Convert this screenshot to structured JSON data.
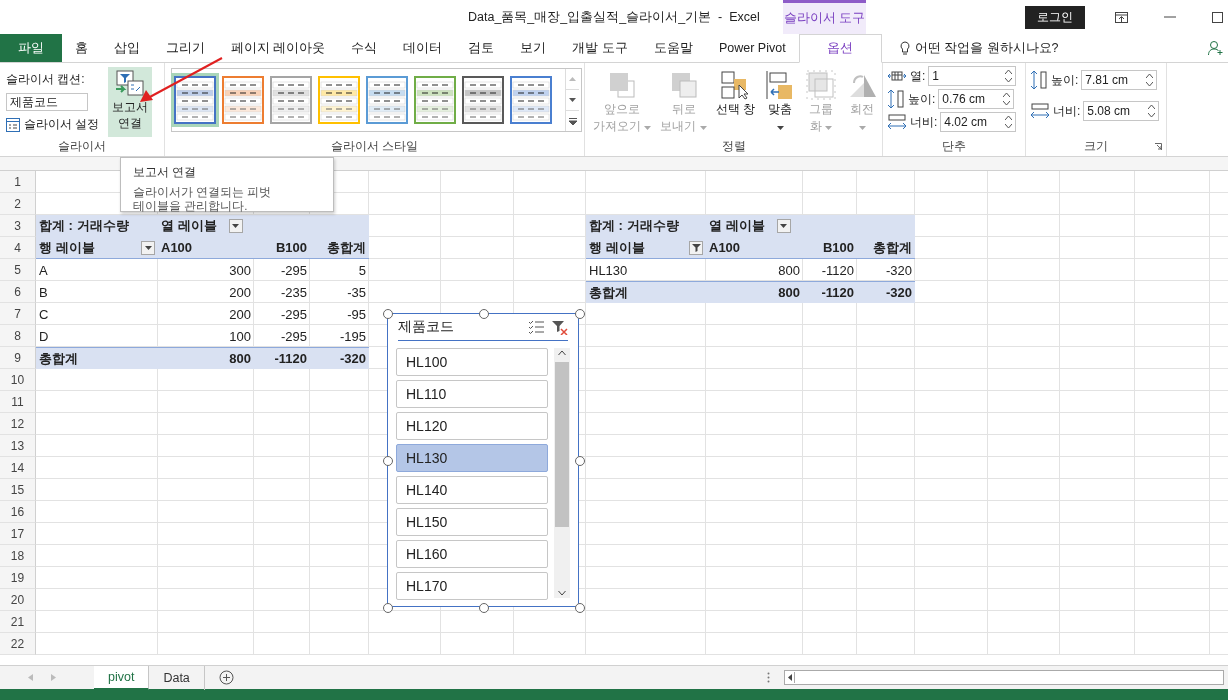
{
  "title_bar": {
    "title": "Data_품목_매장_입출실적_슬라이서_기본  -  Excel",
    "context_tab": "슬라이서 도구",
    "login": "로그인"
  },
  "menu_tabs": [
    {
      "label": "파일",
      "kind": "file",
      "selected": false
    },
    {
      "label": "홈",
      "kind": "tab",
      "selected": false
    },
    {
      "label": "삽입",
      "kind": "tab",
      "selected": false
    },
    {
      "label": "그리기",
      "kind": "tab",
      "selected": false
    },
    {
      "label": "페이지 레이아웃",
      "kind": "tab",
      "selected": false
    },
    {
      "label": "수식",
      "kind": "tab",
      "selected": false
    },
    {
      "label": "데이터",
      "kind": "tab",
      "selected": false
    },
    {
      "label": "검토",
      "kind": "tab",
      "selected": false
    },
    {
      "label": "보기",
      "kind": "tab",
      "selected": false
    },
    {
      "label": "개발 도구",
      "kind": "tab",
      "selected": false
    },
    {
      "label": "도움말",
      "kind": "tab",
      "selected": false
    },
    {
      "label": "Power Pivot",
      "kind": "tab",
      "selected": false
    },
    {
      "label": "옵션",
      "kind": "tab",
      "selected": true
    }
  ],
  "tell_me": "어떤 작업을 원하시나요?",
  "ribbon": {
    "groups": [
      {
        "kind": "slicer",
        "label": "슬라이서",
        "caption_label": "슬라이서 캡션:",
        "caption_value": "제품코드",
        "settings": "슬라이서 설정",
        "report_connection": {
          "label": "보고서 연결",
          "highlighted": true
        }
      },
      {
        "kind": "styles",
        "label": "슬라이서 스타일",
        "styles": [
          {
            "color": "#4472c4",
            "selected": true
          },
          {
            "color": "#ed7d31",
            "selected": false
          },
          {
            "color": "#a5a5a5",
            "selected": false
          },
          {
            "color": "#ffc000",
            "selected": false
          },
          {
            "color": "#5b9bd5",
            "selected": false
          },
          {
            "color": "#70ad47",
            "selected": false
          },
          {
            "color": "#595959",
            "selected": false
          },
          {
            "color": "#4a7fd0",
            "selected": false
          }
        ]
      },
      {
        "kind": "arrange",
        "label": "정렬",
        "buttons": [
          {
            "kind": "bring-forward",
            "lines": [
              "앞으로",
              "가져오기"
            ],
            "disabled": true,
            "dropdown": true
          },
          {
            "kind": "send-backward",
            "lines": [
              "뒤로",
              "보내기"
            ],
            "disabled": true,
            "dropdown": true
          },
          {
            "kind": "selection-pane",
            "lines": [
              "선택 창"
            ],
            "disabled": false,
            "dropdown": false
          },
          {
            "kind": "align",
            "lines": [
              "맞춤"
            ],
            "disabled": false,
            "dropdown": true
          },
          {
            "kind": "group",
            "lines": [
              "그룹",
              "화"
            ],
            "disabled": true,
            "dropdown": true
          },
          {
            "kind": "rotate",
            "lines": [
              "회전"
            ],
            "disabled": true,
            "dropdown": true
          }
        ]
      },
      {
        "kind": "buttons",
        "label": "단추",
        "fields": [
          {
            "kind": "columns",
            "label": "열:",
            "value": "1"
          },
          {
            "kind": "height",
            "label": "높이:",
            "value": "0.76 cm"
          },
          {
            "kind": "width",
            "label": "너비:",
            "value": "4.02 cm"
          }
        ]
      },
      {
        "kind": "size",
        "label": "크기",
        "fields": [
          {
            "kind": "height",
            "label": "높이:",
            "value": "7.81 cm"
          },
          {
            "kind": "width",
            "label": "너비:",
            "value": "5.08 cm"
          }
        ]
      }
    ]
  },
  "tooltip": {
    "title": "보고서 연결",
    "text": "슬라이서가 연결되는 피벗 테이블을 관리합니다."
  },
  "row_numbers": [
    "1",
    "2",
    "3",
    "4",
    "5",
    "6",
    "7",
    "8",
    "9",
    "10",
    "11",
    "12",
    "13",
    "14",
    "15",
    "16",
    "17",
    "18",
    "19",
    "20",
    "21",
    "22"
  ],
  "pivot_tables": [
    {
      "title": "합계 : 거래수량",
      "column_label": "열 레이블",
      "row_label": "행 레이블",
      "row_filtered": false,
      "columns": [
        "A100",
        "B100",
        "총합계"
      ],
      "rows": [
        {
          "label": "A",
          "values": [
            "300",
            "-295",
            "5"
          ]
        },
        {
          "label": "B",
          "values": [
            "200",
            "-235",
            "-35"
          ]
        },
        {
          "label": "C",
          "values": [
            "200",
            "-295",
            "-95"
          ]
        },
        {
          "label": "D",
          "values": [
            "100",
            "-295",
            "-195"
          ]
        }
      ],
      "total": {
        "label": "총합계",
        "values": [
          "800",
          "-1120",
          "-320"
        ]
      }
    },
    {
      "title": "합계 : 거래수량",
      "column_label": "열 레이블",
      "row_label": "행 레이블",
      "row_filtered": true,
      "columns": [
        "A100",
        "B100",
        "총합계"
      ],
      "rows": [
        {
          "label": "HL130",
          "values": [
            "800",
            "-1120",
            "-320"
          ]
        }
      ],
      "total": {
        "label": "총합계",
        "values": [
          "800",
          "-1120",
          "-320"
        ]
      }
    }
  ],
  "slicer": {
    "title": "제품코드",
    "items": [
      {
        "label": "HL100",
        "selected": false
      },
      {
        "label": "HL110",
        "selected": false
      },
      {
        "label": "HL120",
        "selected": false
      },
      {
        "label": "HL130",
        "selected": true
      },
      {
        "label": "HL140",
        "selected": false
      },
      {
        "label": "HL150",
        "selected": false
      },
      {
        "label": "HL160",
        "selected": false
      },
      {
        "label": "HL170",
        "selected": false
      }
    ]
  },
  "sheet_tabs": [
    {
      "label": "pivot",
      "selected": true
    },
    {
      "label": "Data",
      "selected": false
    }
  ]
}
